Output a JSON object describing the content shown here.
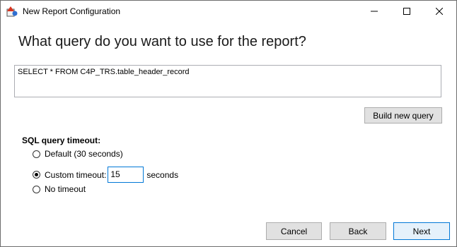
{
  "window": {
    "title": "New Report Configuration",
    "icon": "report-app-icon"
  },
  "controls": {
    "minimize": "minimize-icon",
    "maximize": "maximize-icon",
    "close": "close-icon"
  },
  "heading": "What query do you want to use for the report?",
  "query": {
    "value": "SELECT * FROM C4P_TRS.table_header_record"
  },
  "build_button": "Build new query",
  "timeout": {
    "label": "SQL query timeout:",
    "options": [
      {
        "label": "Default (30 seconds)",
        "selected": false
      },
      {
        "label": "Custom timeout:",
        "selected": true
      },
      {
        "label": "No timeout",
        "selected": false
      }
    ],
    "custom_value": "15",
    "custom_unit": "seconds"
  },
  "footer": {
    "cancel": "Cancel",
    "back": "Back",
    "next": "Next"
  },
  "colors": {
    "accent": "#0078d7",
    "button_bg": "#e1e1e1",
    "next_bg": "#e5f1fb"
  }
}
